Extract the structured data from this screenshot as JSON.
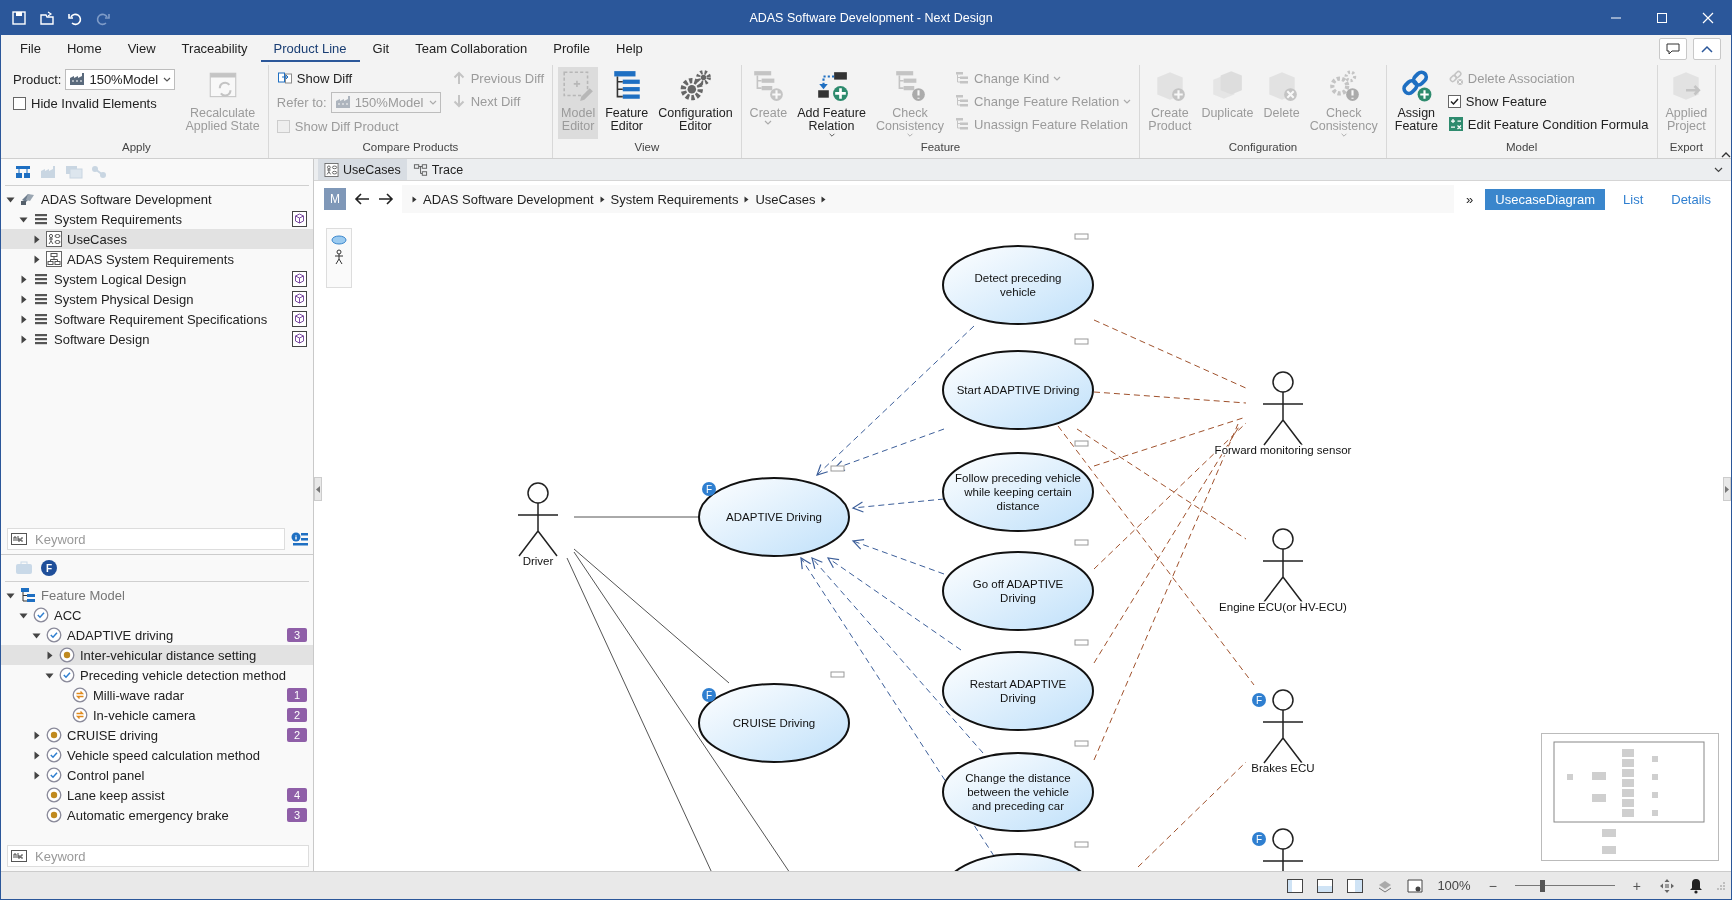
{
  "window": {
    "title": "ADAS Software Development - Next Design"
  },
  "menu_tabs": [
    {
      "label": "File",
      "selected": false
    },
    {
      "label": "Home",
      "selected": false
    },
    {
      "label": "View",
      "selected": false
    },
    {
      "label": "Traceability",
      "selected": false
    },
    {
      "label": "Product Line",
      "selected": true
    },
    {
      "label": "Git",
      "selected": false
    },
    {
      "label": "Team Collaboration",
      "selected": false
    },
    {
      "label": "Profile",
      "selected": false
    },
    {
      "label": "Help",
      "selected": false
    }
  ],
  "ribbon_groups": [
    {
      "title": "Apply",
      "columns": [
        [
          {
            "kind": "combo",
            "label": "Product:",
            "value": "150%Model",
            "disabled": false
          },
          {
            "kind": "check",
            "label": "Hide Invalid Elements",
            "checked": false,
            "disabled": false
          }
        ],
        [
          {
            "kind": "large",
            "label": "Recalculate\nApplied State",
            "disabled": true,
            "dropdown": false
          }
        ]
      ]
    },
    {
      "title": "Compare Products",
      "columns": [
        [
          {
            "kind": "small",
            "label": "Show Diff",
            "disabled": false,
            "dropdown": false
          },
          {
            "kind": "combo",
            "label": "Refer to:",
            "value": "150%Model",
            "disabled": true
          },
          {
            "kind": "check",
            "label": "Show Diff Product",
            "checked": false,
            "disabled": true
          }
        ],
        [
          {
            "kind": "small",
            "label": "Previous Diff",
            "disabled": true,
            "dropdown": false
          },
          {
            "kind": "small",
            "label": "Next Diff",
            "disabled": true,
            "dropdown": false
          }
        ]
      ]
    },
    {
      "title": "View",
      "columns": [
        [
          {
            "kind": "large",
            "label": "Model\nEditor",
            "disabled": true,
            "selected": true,
            "dropdown": false
          }
        ],
        [
          {
            "kind": "large",
            "label": "Feature\nEditor",
            "disabled": false,
            "selected": false,
            "dropdown": false
          }
        ],
        [
          {
            "kind": "large",
            "label": "Configuration\nEditor",
            "disabled": false,
            "selected": false,
            "dropdown": false
          }
        ]
      ]
    },
    {
      "title": "Feature",
      "columns": [
        [
          {
            "kind": "large",
            "label": "Create",
            "disabled": true,
            "dropdown": true
          }
        ],
        [
          {
            "kind": "large",
            "label": "Add Feature\nRelation",
            "disabled": false,
            "dropdown": true
          }
        ],
        [
          {
            "kind": "large",
            "label": "Check\nConsistency",
            "disabled": true,
            "dropdown": true
          }
        ],
        [
          {
            "kind": "small",
            "label": "Change Kind",
            "disabled": true,
            "dropdown": true
          },
          {
            "kind": "small",
            "label": "Change Feature Relation",
            "disabled": true,
            "dropdown": true
          },
          {
            "kind": "small",
            "label": "Unassign Feature Relation",
            "disabled": true,
            "dropdown": false
          }
        ]
      ]
    },
    {
      "title": "Configuration",
      "columns": [
        [
          {
            "kind": "large",
            "label": "Create\nProduct",
            "disabled": true,
            "dropdown": false
          }
        ],
        [
          {
            "kind": "large",
            "label": "Duplicate",
            "disabled": true,
            "dropdown": false
          }
        ],
        [
          {
            "kind": "large",
            "label": "Delete",
            "disabled": true,
            "dropdown": false
          }
        ],
        [
          {
            "kind": "large",
            "label": "Check\nConsistency",
            "disabled": true,
            "dropdown": true
          }
        ]
      ]
    },
    {
      "title": "Model",
      "columns": [
        [
          {
            "kind": "large",
            "label": "Assign\nFeature",
            "disabled": false,
            "dropdown": false
          }
        ],
        [
          {
            "kind": "small",
            "label": "Delete Association",
            "disabled": true,
            "dropdown": false
          },
          {
            "kind": "check",
            "label": "Show Feature",
            "checked": true,
            "disabled": false
          },
          {
            "kind": "small",
            "label": "Edit Feature Condition Formula",
            "disabled": false,
            "dropdown": false
          }
        ]
      ]
    },
    {
      "title": "Export",
      "columns": [
        [
          {
            "kind": "large",
            "label": "Applied\nProject",
            "disabled": true,
            "dropdown": false
          }
        ]
      ]
    }
  ],
  "model_tree": [
    {
      "label": "ADAS Software Development",
      "kind": "project",
      "expanded": true,
      "selected": false,
      "linked": false,
      "children": [
        {
          "label": "System Requirements",
          "kind": "package",
          "expanded": true,
          "selected": false,
          "linked": true,
          "children": [
            {
              "label": "UseCases",
              "kind": "usecases",
              "expanded": false,
              "selected": true,
              "linked": false
            },
            {
              "label": "ADAS System Requirements",
              "kind": "diagram",
              "expanded": false,
              "selected": false,
              "linked": false
            }
          ]
        },
        {
          "label": "System Logical Design",
          "kind": "package",
          "expanded": false,
          "selected": false,
          "linked": true
        },
        {
          "label": "System Physical Design",
          "kind": "package",
          "expanded": false,
          "selected": false,
          "linked": true
        },
        {
          "label": "Software Requirement Specifications",
          "kind": "package",
          "expanded": false,
          "selected": false,
          "linked": true
        },
        {
          "label": "Software Design",
          "kind": "package",
          "expanded": false,
          "selected": false,
          "linked": true
        }
      ]
    }
  ],
  "model_search": {
    "placeholder": "Keyword"
  },
  "feature_toolbar": {
    "badge": "F"
  },
  "feature_tree": [
    {
      "label": "Feature Model",
      "kind": "model",
      "expanded": true,
      "selected": false,
      "children": [
        {
          "label": "ACC",
          "kind": "mandatory",
          "expanded": true,
          "selected": false,
          "children": [
            {
              "label": "ADAPTIVE driving",
              "kind": "mandatory",
              "expanded": true,
              "selected": false,
              "count": "3",
              "children": [
                {
                  "label": "Inter-vehicular distance setting",
                  "kind": "optional",
                  "expanded": false,
                  "selected": true
                },
                {
                  "label": "Preceding vehicle detection method",
                  "kind": "mandatory",
                  "expanded": true,
                  "selected": false,
                  "children": [
                    {
                      "label": "Milli-wave radar",
                      "kind": "alternative",
                      "selected": false,
                      "count": "1"
                    },
                    {
                      "label": "In-vehicle camera",
                      "kind": "alternative",
                      "selected": false,
                      "count": "2"
                    }
                  ]
                }
              ]
            },
            {
              "label": "CRUISE driving",
              "kind": "optional",
              "expanded": false,
              "selected": false,
              "count": "2"
            },
            {
              "label": "Vehicle speed calculation method",
              "kind": "mandatory",
              "expanded": false,
              "selected": false
            },
            {
              "label": "Control panel",
              "kind": "mandatory",
              "expanded": false,
              "selected": false
            },
            {
              "label": "Lane keep assist",
              "kind": "optional",
              "selected": false,
              "count": "4"
            },
            {
              "label": "Automatic emergency brake",
              "kind": "optional",
              "selected": false,
              "count": "3"
            }
          ]
        }
      ]
    }
  ],
  "feature_search": {
    "placeholder": "Keyword"
  },
  "doc_tabs": [
    {
      "label": "UseCases",
      "selected": true
    },
    {
      "label": "Trace",
      "selected": false
    }
  ],
  "mode_button": "M",
  "breadcrumb": [
    "ADAS Software Development",
    "System Requirements",
    "UseCases"
  ],
  "more": "»",
  "view_switch": [
    {
      "label": "UsecaseDiagram",
      "selected": true
    },
    {
      "label": "List",
      "selected": false
    },
    {
      "label": "Details",
      "selected": false
    }
  ],
  "diagram": {
    "use_cases": [
      {
        "kind": "use_case",
        "label": "Detect preceding\nvehicle"
      },
      {
        "kind": "use_case",
        "label": "Start ADAPTIVE Driving"
      },
      {
        "kind": "use_case",
        "label": "Follow preceding vehicle\nwhile keeping certain\ndistance"
      },
      {
        "kind": "use_case",
        "label": "ADAPTIVE Driving",
        "badge": "F"
      },
      {
        "kind": "use_case",
        "label": "Go off ADAPTIVE\nDriving"
      },
      {
        "kind": "use_case",
        "label": "Restart ADAPTIVE\nDriving"
      },
      {
        "kind": "use_case",
        "label": "CRUISE Driving",
        "badge": "F"
      },
      {
        "kind": "use_case",
        "label": "Change the distance\nbetween the vehicle\nand preceding car"
      },
      {
        "kind": "use_case"
      }
    ],
    "actors": [
      {
        "label": "Driver"
      },
      {
        "label": "Forward monitoring sensor"
      },
      {
        "label": "Engine ECU(or HV-ECU)"
      },
      {
        "label": "Brakes ECU",
        "badge": "F"
      },
      {
        "badge": "F"
      }
    ]
  },
  "status_bar": {
    "zoom": "100%",
    "zoom_out": "−",
    "zoom_in": "+",
    "zoom_slider": {
      "level": 0.27
    }
  }
}
